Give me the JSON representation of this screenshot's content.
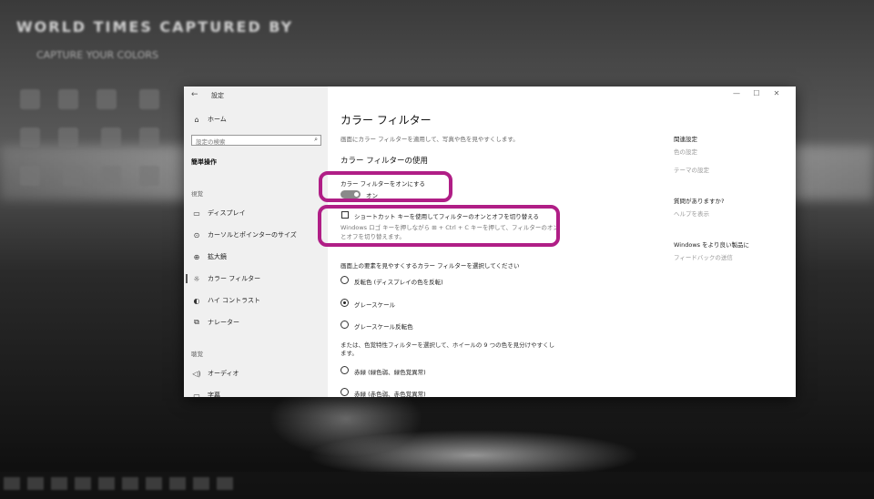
{
  "desktop": {
    "watermark": "WORLD TIMES CAPTURED BY",
    "subtitle": "CAPTURE YOUR COLORS"
  },
  "window": {
    "title": "設定",
    "controls": {
      "minimize": "—",
      "maximize": "☐",
      "close": "✕"
    }
  },
  "sidebar": {
    "home": "ホーム",
    "search_placeholder": "設定の検索",
    "section_title": "簡単操作",
    "vision_label": "視覚",
    "items": [
      {
        "label": "ディスプレイ",
        "icon": "display-icon"
      },
      {
        "label": "カーソルとポインターのサイズ",
        "icon": "cursor-icon"
      },
      {
        "label": "拡大鏡",
        "icon": "magnifier-icon"
      },
      {
        "label": "カラー フィルター",
        "icon": "color-filter-icon"
      },
      {
        "label": "ハイ コントラスト",
        "icon": "contrast-icon"
      },
      {
        "label": "ナレーター",
        "icon": "narrator-icon"
      }
    ],
    "hearing_label": "聴覚",
    "hearing_items": [
      {
        "label": "オーディオ",
        "icon": "audio-icon"
      },
      {
        "label": "字幕",
        "icon": "caption-icon"
      }
    ]
  },
  "main": {
    "title": "カラー フィルター",
    "description": "画面にカラー フィルターを適用して、写真や色を見やすくします。",
    "use_heading": "カラー フィルターの使用",
    "toggle_label": "カラー フィルターをオンにする",
    "toggle_state": "オン",
    "shortcut_label": "ショートカット キーを使用してフィルターのオンとオフを切り替える",
    "shortcut_desc": "Windows ロゴ キーを押しながら ⊞ + Ctrl + C キーを押して、フィルターのオンとオフを切り替えます。",
    "select_prompt": "画面上の要素を見やすくするカラー フィルターを選択してください",
    "filters": [
      {
        "label": "反転色 (ディスプレイの色を反転)",
        "checked": false
      },
      {
        "label": "グレースケール",
        "checked": true
      },
      {
        "label": "グレースケール反転色",
        "checked": false
      }
    ],
    "cvd_prompt": "または、色覚特性フィルターを選択して、ホイールの 9 つの色を見分けやすくします。",
    "cvd_filters": [
      {
        "label": "赤緑 (緑色弱、緑色覚異常)",
        "checked": false
      },
      {
        "label": "赤緑 (赤色弱、赤色覚異常)",
        "checked": false
      }
    ]
  },
  "aside": {
    "related_heading": "関連設定",
    "related_links": [
      "色の設定",
      "テーマの設定"
    ],
    "question_heading": "質問がありますか?",
    "help_link": "ヘルプを表示",
    "improve_heading": "Windows をより良い製品に",
    "feedback_link": "フィードバックの送信"
  },
  "annotation_color": "#b01e86"
}
